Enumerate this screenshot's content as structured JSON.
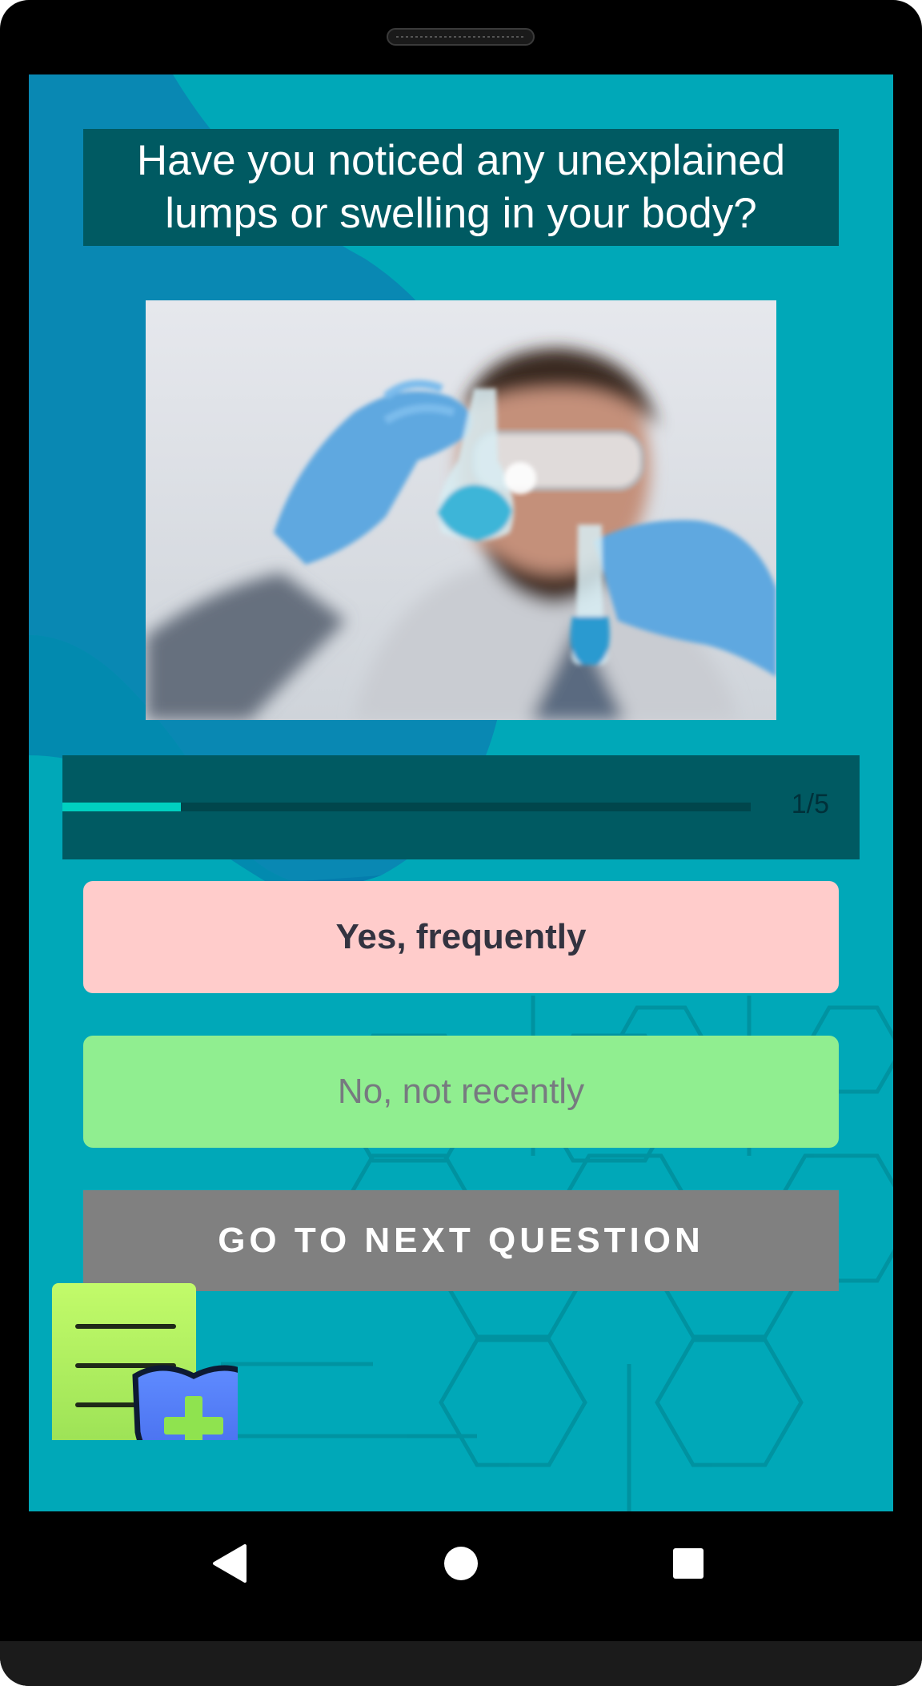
{
  "question": {
    "text": "Have you noticed any unexplained lumps or swelling in your body?"
  },
  "photo": {
    "subject": "scientist holding flasks of blue liquid"
  },
  "progress": {
    "label": "1/5",
    "fraction": 0.2
  },
  "answers": [
    {
      "label": "Yes, frequently",
      "color": "#ffcccb"
    },
    {
      "label": "No, not recently",
      "color": "#90ee90"
    }
  ],
  "next_button": {
    "label": "GO TO NEXT QUESTION"
  },
  "nav": {
    "back_icon": "back-triangle-icon",
    "home_icon": "home-circle-icon",
    "recents_icon": "recents-square-icon"
  },
  "colors": {
    "screen_background": "#00a8b8",
    "panel": "#005a62",
    "progress_fill": "#00d0c0",
    "next_button": "#808080"
  }
}
